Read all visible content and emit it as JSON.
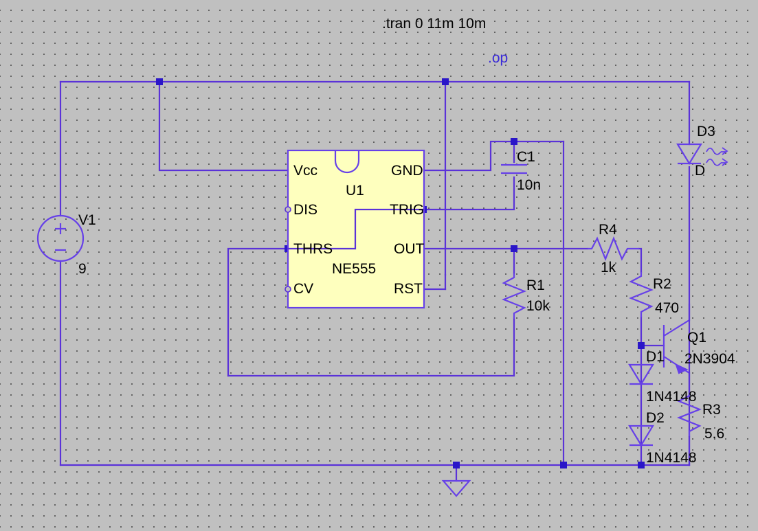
{
  "sheet": {
    "background_color": "#c0c0c0",
    "wire_color": "#5a32d8",
    "text_color": "#000000",
    "directive_color": "#3a2ad8",
    "ic_fill_color": "#feffbe"
  },
  "directives": [
    {
      "text": ".tran 0 11m 10m",
      "color": "black"
    },
    {
      "text": ".op",
      "color": "blue"
    }
  ],
  "ic": {
    "ref": "U1",
    "part": "NE555",
    "pins_left": [
      "Vcc",
      "DIS",
      "THRS",
      "CV"
    ],
    "pins_right": [
      "GND",
      "TRIG",
      "OUT",
      "RST"
    ]
  },
  "components": [
    {
      "ref": "V1",
      "value": "9",
      "type": "voltage-source"
    },
    {
      "ref": "C1",
      "value": "10n",
      "type": "capacitor"
    },
    {
      "ref": "R1",
      "value": "10k",
      "type": "resistor"
    },
    {
      "ref": "R2",
      "value": "470",
      "type": "resistor"
    },
    {
      "ref": "R3",
      "value": "5.6",
      "type": "resistor"
    },
    {
      "ref": "R4",
      "value": "1k",
      "type": "resistor"
    },
    {
      "ref": "D1",
      "value": "1N4148",
      "type": "diode"
    },
    {
      "ref": "D2",
      "value": "1N4148",
      "type": "diode"
    },
    {
      "ref": "D3",
      "value": "D",
      "type": "led"
    },
    {
      "ref": "Q1",
      "value": "2N3904",
      "type": "npn-transistor"
    }
  ],
  "labels": {
    "v1_ref": "V1",
    "v1_value": "9",
    "c1_ref": "C1",
    "c1_value": "10n",
    "r1_ref": "R1",
    "r1_value": "10k",
    "r2_ref": "R2",
    "r2_value": "470",
    "r3_ref": "R3",
    "r3_value": "5.6",
    "r4_ref": "R4",
    "r4_value": "1k",
    "d1_ref": "D1",
    "d1_value": "1N4148",
    "d2_ref": "D2",
    "d2_value": "1N4148",
    "d3_ref": "D3",
    "d3_value": "D",
    "q1_ref": "Q1",
    "q1_value": "2N3904",
    "u1_ref": "U1",
    "u1_part": "NE555",
    "pin_vcc": "Vcc",
    "pin_dis": "DIS",
    "pin_thrs": "THRS",
    "pin_cv": "CV",
    "pin_gnd": "GND",
    "pin_trig": "TRIG",
    "pin_out": "OUT",
    "pin_rst": "RST",
    "directive_tran": ".tran 0 11m 10m",
    "directive_op": ".op"
  }
}
